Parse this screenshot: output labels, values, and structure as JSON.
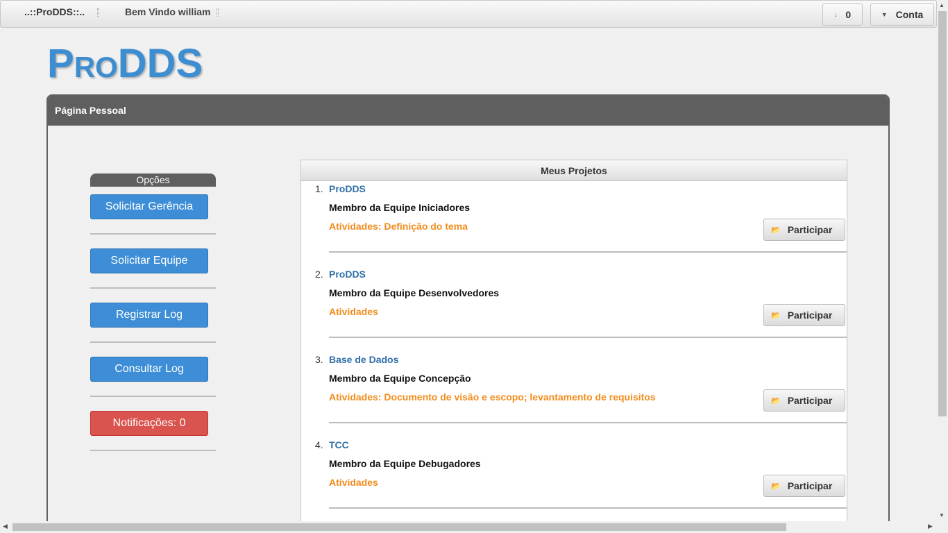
{
  "topbar": {
    "brand": "..::ProDDS::..",
    "welcome": "Bem Vindo william",
    "download_icon": "arrow-down-icon",
    "download_count": "0",
    "account_icon": "caret-down-icon",
    "account_label": "Conta"
  },
  "logo": {
    "first_big": "P",
    "first_small": "RO",
    "rest": "DDS"
  },
  "panel": {
    "title": "Página Pessoal"
  },
  "options": {
    "title": "Opções",
    "buttons": [
      {
        "label": "Solicitar Gerência"
      },
      {
        "label": "Solicitar Equipe"
      },
      {
        "label": "Registrar Log"
      },
      {
        "label": "Consultar Log"
      },
      {
        "label": "Notificações: 0"
      }
    ]
  },
  "projects": {
    "title": "Meus Projetos",
    "participate_label": "Participar",
    "participate_icon": "folder-open-icon",
    "items": [
      {
        "num": "1.",
        "name": "ProDDS",
        "team": "Membro da Equipe Iniciadores",
        "activities": "Atividades: Definição do tema"
      },
      {
        "num": "2.",
        "name": "ProDDS",
        "team": "Membro da Equipe Desenvolvedores",
        "activities": "Atividades"
      },
      {
        "num": "3.",
        "name": "Base de Dados",
        "team": "Membro da Equipe Concepção",
        "activities": "Atividades: Documento de visão e escopo; levantamento de requisitos"
      },
      {
        "num": "4.",
        "name": "TCC",
        "team": "Membro da Equipe Debugadores",
        "activities": "Atividades"
      }
    ]
  },
  "colors": {
    "accent_blue": "#3d8ed6",
    "danger_red": "#d9534f",
    "activity_orange": "#f28c1c",
    "header_gray": "#5f5f5f"
  }
}
